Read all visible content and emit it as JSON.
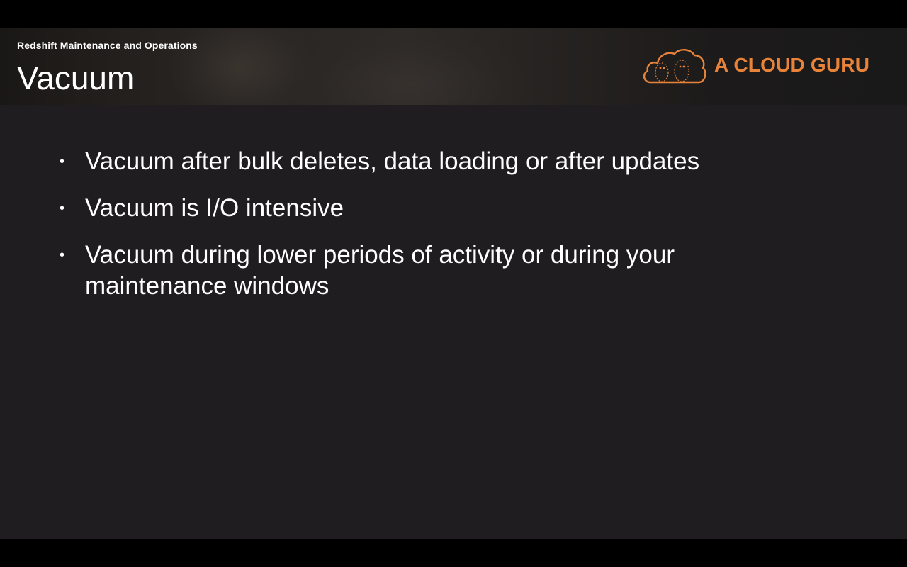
{
  "slide": {
    "subtitle": "Redshift Maintenance and Operations",
    "title": "Vacuum",
    "logo": {
      "text": "A CLOUD GURU",
      "icon": "cloud-icon",
      "color": "#e8833a"
    },
    "bullet_glyph": "•",
    "bullets": [
      {
        "text": "Vacuum after bulk deletes, data loading or after updates"
      },
      {
        "text": "Vacuum is I/O intensive"
      },
      {
        "text": "Vacuum during lower periods of activity or during your maintenance windows"
      }
    ]
  },
  "colors": {
    "slide_background": "#1f1d20",
    "text": "#ffffff",
    "accent": "#e8833a"
  }
}
